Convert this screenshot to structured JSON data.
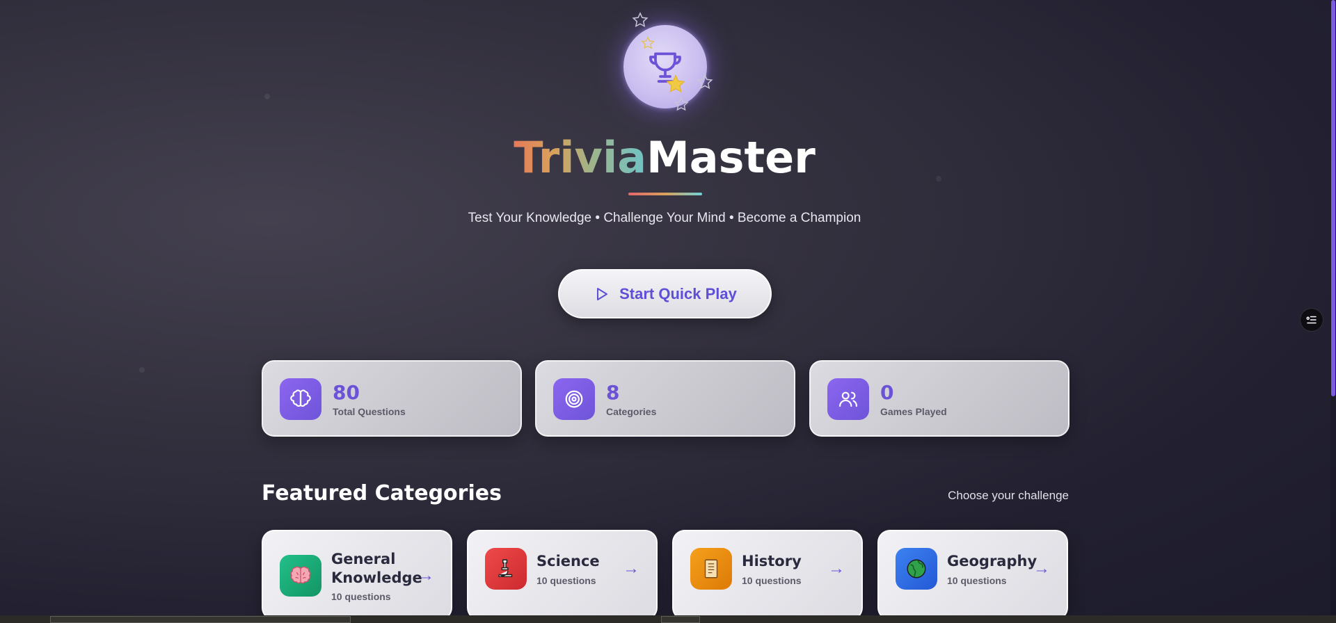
{
  "hero": {
    "title_part1": "Trivia",
    "title_part2": "Master",
    "tagline": "Test Your Knowledge • Challenge Your Mind • Become a Champion"
  },
  "quick_play": {
    "label": "Start Quick Play",
    "icon": "play-icon"
  },
  "stats": [
    {
      "value": "80",
      "label": "Total Questions",
      "icon": "brain-icon"
    },
    {
      "value": "8",
      "label": "Categories",
      "icon": "target-icon"
    },
    {
      "value": "0",
      "label": "Games Played",
      "icon": "users-icon"
    }
  ],
  "featured": {
    "title": "Featured Categories",
    "subtitle": "Choose your challenge"
  },
  "categories": [
    {
      "name": "General Knowledge",
      "count": "10 questions",
      "icon": "brain-emoji-icon",
      "color": "#1fae7a",
      "arrow": "→"
    },
    {
      "name": "Science",
      "count": "10 questions",
      "icon": "microscope-icon",
      "color": "#e0393c",
      "arrow": "→"
    },
    {
      "name": "History",
      "count": "10 questions",
      "icon": "scroll-icon",
      "color": "#ee8a12",
      "arrow": "→"
    },
    {
      "name": "Geography",
      "count": "10 questions",
      "icon": "globe-icon",
      "color": "#2f6fe6",
      "arrow": "→"
    }
  ],
  "colors": {
    "accent": "#6c52d6",
    "background": "#2c2a3a"
  }
}
